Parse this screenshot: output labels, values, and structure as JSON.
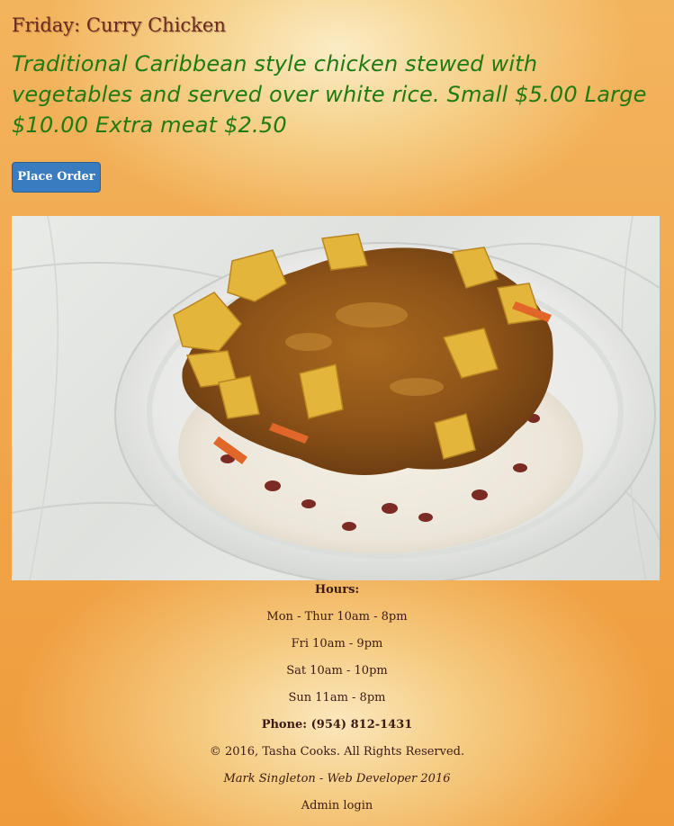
{
  "menu_item": {
    "title": "Friday: Curry Chicken",
    "description": "Traditional Caribbean style chicken stewed with vegetables and served over white rice. Small $5.00 Large $10.00 Extra meat $2.50",
    "order_button_label": "Place Order"
  },
  "footer": {
    "hours_heading": "Hours:",
    "hours": [
      "Mon - Thur 10am - 8pm",
      "Fri 10am - 9pm",
      "Sat 10am - 10pm",
      "Sun 11am - 8pm"
    ],
    "phone": "Phone: (954) 812-1431",
    "copyright": "© 2016, Tasha Cooks. All Rights Reserved.",
    "developer": "Mark Singleton - Web Developer 2016",
    "admin_link": "Admin login"
  },
  "colors": {
    "title": "#6b2a20",
    "description": "#1f7a12",
    "button": "#3a7cc0",
    "background": "#f0a447"
  }
}
